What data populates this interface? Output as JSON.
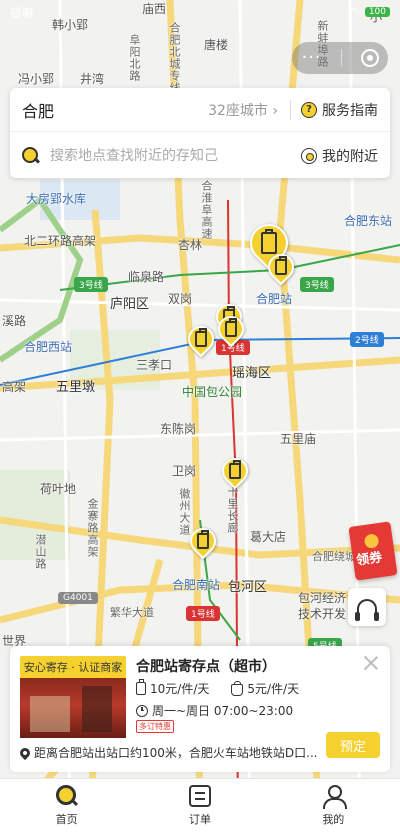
{
  "status_bar": {
    "left": "锁嘛",
    "right": "100"
  },
  "search": {
    "city": "合肥",
    "city_count": "32座城市",
    "guide_label": "服务指南",
    "placeholder": "搜索地点查找附近的存知己",
    "nearby_label": "我的附近"
  },
  "map": {
    "labels": [
      "韩小郢",
      "小",
      "阜阳北路",
      "合肥北城专线",
      "庙西",
      "合淮阜高速",
      "唐楼",
      "冯小郢",
      "井湾",
      "新蚌埠路",
      "大房郢水库",
      "合肥东站",
      "杏林",
      "北二环路高架",
      "临泉路",
      "庐阳区",
      "双岗",
      "合肥站",
      "溪路",
      "合肥西站",
      "三孝口",
      "瑶海区",
      "五里墩",
      "中国包公园",
      "高架",
      "东陈岗",
      "五里庙",
      "卫岗",
      "荷叶地",
      "徽州大道",
      "葛大店",
      "潜山路",
      "合肥南站",
      "包河区",
      "合肥绕城",
      "繁华大道",
      "包河经济技术开发",
      "世界",
      "金寨路高架",
      "十里长廊"
    ],
    "line_badges": [
      "3号线",
      "3号线",
      "2号线",
      "1号线",
      "1号线",
      "5号线",
      "G4001"
    ]
  },
  "store": {
    "cert_tag": "安心寄存 · 认证商家",
    "name": "合肥站寄存点（超市）",
    "price_luggage": "10元/件/天",
    "price_bag": "5元/件/天",
    "hours": "周一~周日 07:00~23:00",
    "tag": "多订特惠",
    "address": "距离合肥站出站口约100米，合肥火车站地铁站D口...",
    "book_label": "预定"
  },
  "coupon_label": "领券",
  "tabs": [
    {
      "label": "首页",
      "icon": "search-home-icon"
    },
    {
      "label": "订单",
      "icon": "order-icon"
    },
    {
      "label": "我的",
      "icon": "user-icon"
    }
  ],
  "colors": {
    "accent": "#f4d12f",
    "metro_red": "#d93333",
    "metro_green": "#3aa64a",
    "metro_blue": "#2f7fd6"
  }
}
